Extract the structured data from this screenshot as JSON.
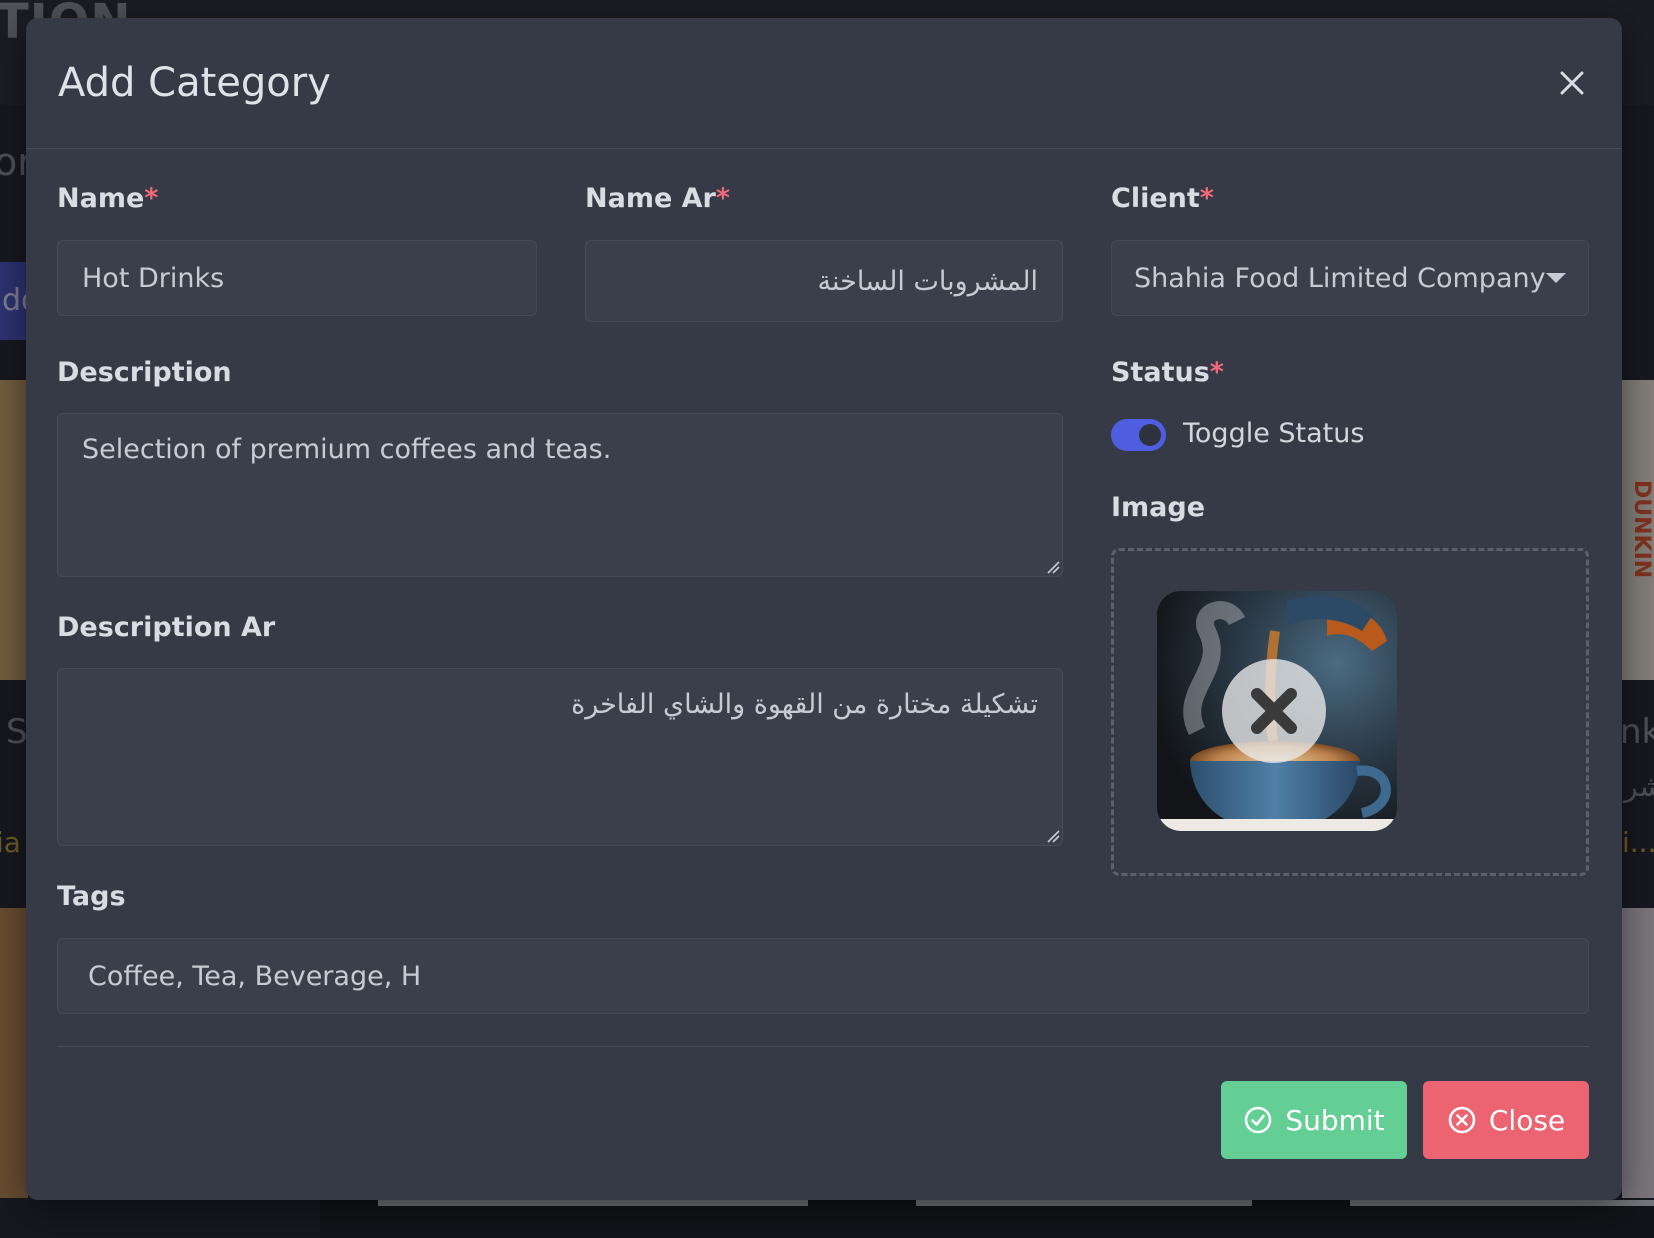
{
  "background": {
    "title": "TION",
    "subtitle": "ori",
    "add_button": "dd",
    "left_card_label": "S",
    "left_card_sub": "ia",
    "right_card_label": "nks",
    "right_card_ar": "شر",
    "right_card_sub": "i...",
    "right_logo": "DUNKIN"
  },
  "modal": {
    "title": "Add Category",
    "fields": {
      "name": {
        "label": "Name",
        "required": "*",
        "value": "Hot Drinks"
      },
      "name_ar": {
        "label": "Name Ar",
        "required": "*",
        "value": "المشروبات الساخنة"
      },
      "client": {
        "label": "Client",
        "required": "*",
        "value": "Shahia Food Limited Company"
      },
      "description": {
        "label": "Description",
        "value": "Selection of premium coffees and teas."
      },
      "description_ar": {
        "label": "Description Ar",
        "value": "تشكيلة مختارة من القهوة والشاي الفاخرة"
      },
      "status": {
        "label": "Status",
        "required": "*",
        "toggle_label": "Toggle Status",
        "on": true
      },
      "image": {
        "label": "Image"
      },
      "tags": {
        "label": "Tags",
        "value": "Coffee, Tea, Beverage, H"
      }
    },
    "buttons": {
      "submit": "Submit",
      "close": "Close"
    }
  },
  "colors": {
    "accent": "#4f5ee0",
    "submit": "#63cf94",
    "close": "#ec6472",
    "required": "#f06a79"
  },
  "icons": {
    "close": "close-icon",
    "caret": "chevron-down-icon",
    "submit": "check-circle-icon",
    "close_btn": "x-circle-icon",
    "remove_image": "x-icon"
  }
}
